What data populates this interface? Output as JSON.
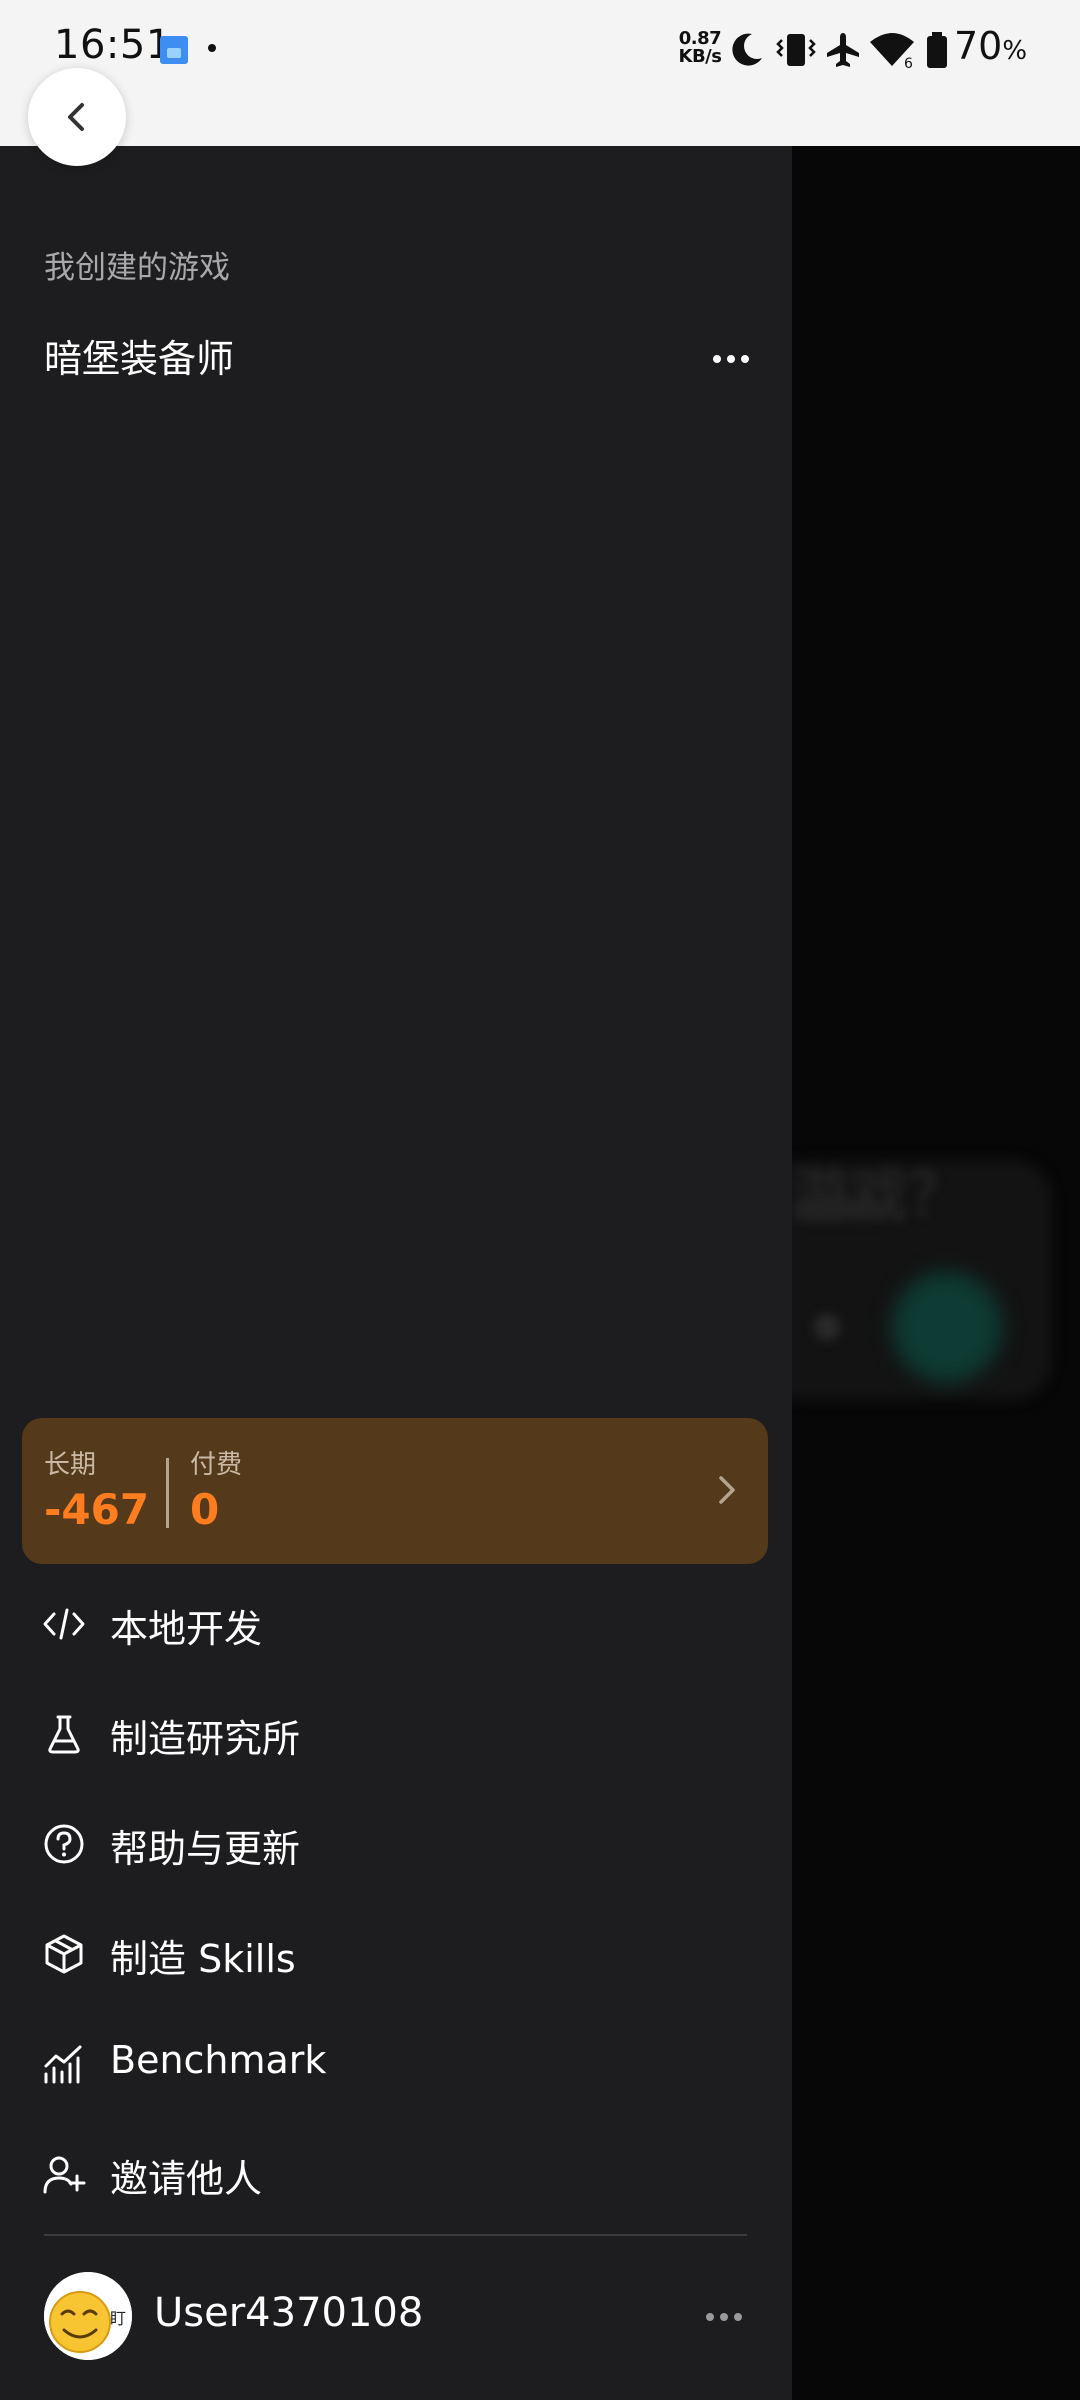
{
  "status_bar": {
    "time": "16:51",
    "net_speed_value": "0.87",
    "net_speed_unit": "KB/s",
    "battery_value": "70",
    "battery_unit": "%",
    "wifi_badge": "6",
    "icons": [
      "app-notification-icon",
      "moon-icon",
      "vibrate-icon",
      "airplane-icon",
      "wifi-icon",
      "battery-icon"
    ]
  },
  "drawer": {
    "section_label": "我创建的游戏",
    "games": [
      {
        "title": "暗堡装备师"
      }
    ],
    "stats": {
      "long_label": "长期",
      "long_value": "-467",
      "paid_label": "付费",
      "paid_value": "0"
    },
    "menu": [
      {
        "label": "本地开发",
        "icon": "code-icon"
      },
      {
        "label": "制造研究所",
        "icon": "flask-icon"
      },
      {
        "label": "帮助与更新",
        "icon": "help-circle-icon"
      },
      {
        "label": "制造 Skills",
        "icon": "box-icon"
      },
      {
        "label": "Benchmark",
        "icon": "chart-icon"
      },
      {
        "label": "邀请他人",
        "icon": "user-plus-icon"
      }
    ],
    "user": {
      "name": "User4370108",
      "avatar_badge": "盯"
    }
  },
  "background": {
    "blurred_text": "游戏？"
  },
  "colors": {
    "drawer_bg": "#1d1d1f",
    "stats_bg": "#54391a",
    "accent_orange": "#ff7d1f"
  }
}
